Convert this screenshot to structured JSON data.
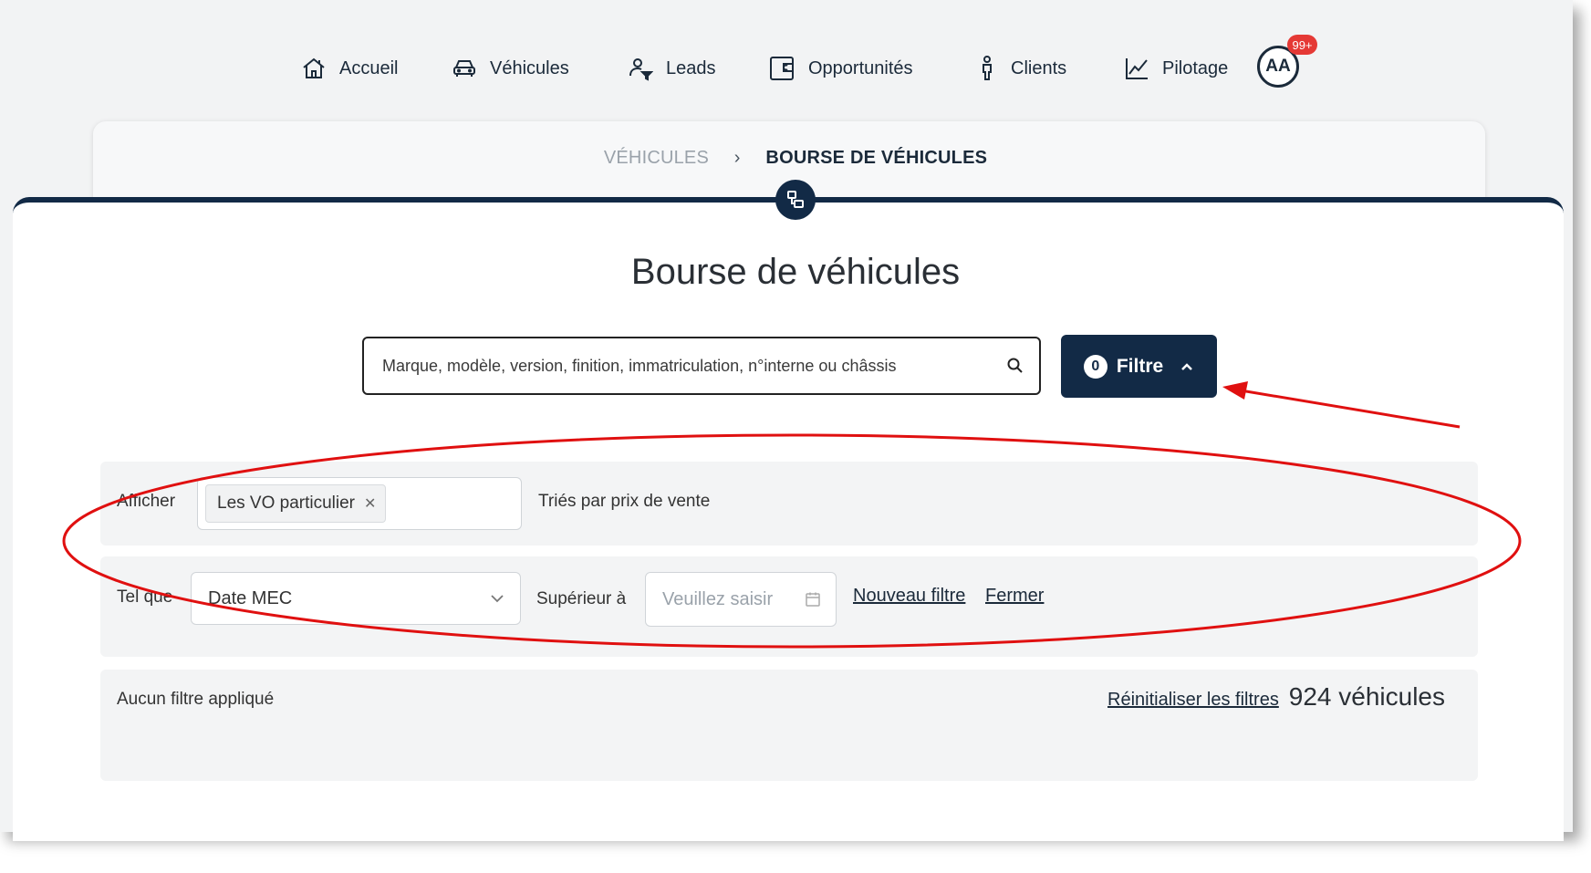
{
  "nav": {
    "items": [
      {
        "label": "Accueil",
        "icon": "home-icon"
      },
      {
        "label": "Véhicules",
        "icon": "car-icon"
      },
      {
        "label": "Leads",
        "icon": "user-filter-icon"
      },
      {
        "label": "Opportunités",
        "icon": "wallet-icon"
      },
      {
        "label": "Clients",
        "icon": "person-icon"
      },
      {
        "label": "Pilotage",
        "icon": "chart-line-icon"
      }
    ],
    "avatar_initials": "AA",
    "notification_badge": "99+"
  },
  "breadcrumb": {
    "parent": "VÉHICULES",
    "current": "BOURSE DE VÉHICULES"
  },
  "page": {
    "title": "Bourse de véhicules"
  },
  "search": {
    "placeholder": "Marque, modèle, version, finition, immatriculation, n°interne ou châssis"
  },
  "filter_button": {
    "count": "0",
    "label": "Filtre"
  },
  "filters": {
    "show_label": "Afficher",
    "show_tag": "Les VO particulier",
    "sort_text": "Triés par prix de vente",
    "condition_label": "Tel que",
    "field_select_value": "Date MEC",
    "operator_label": "Supérieur à",
    "date_placeholder": "Veuillez saisir",
    "new_filter_link": "Nouveau filtre",
    "close_link": "Fermer"
  },
  "summary": {
    "applied_text": "Aucun filtre appliqué",
    "reset_link": "Réinitialiser les filtres",
    "vehicle_count": "924 véhicules"
  },
  "colors": {
    "primary": "#122a46",
    "badge": "#e53935",
    "annotation": "#e01010"
  }
}
